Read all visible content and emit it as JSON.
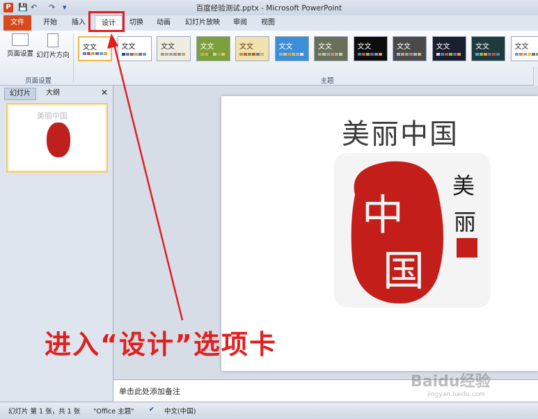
{
  "window": {
    "title": "百度经验测试.pptx - Microsoft PowerPoint",
    "app_icon": "P"
  },
  "qat": {
    "save": "💾",
    "undo": "↶",
    "redo": "↷",
    "more": "▾"
  },
  "ribbon_tabs": [
    "文件",
    "开始",
    "插入",
    "设计",
    "切换",
    "动画",
    "幻灯片放映",
    "审阅",
    "视图"
  ],
  "ribbon": {
    "page_setup_label": "页面设置",
    "orientation_label": "幻灯片方向",
    "group_page_setup": "页面设置",
    "group_themes": "主题",
    "theme_label": "文文"
  },
  "themes": [
    {
      "bg": "#ffffff",
      "fg": "#222222",
      "accents": [
        "#4f81bd",
        "#c0504d",
        "#9bbb59",
        "#8064a2",
        "#4bacc6",
        "#f79646"
      ]
    },
    {
      "bg": "#ffffff",
      "fg": "#222222",
      "accents": [
        "#1f497d",
        "#4f81bd",
        "#c0504d",
        "#9bbb59",
        "#8064a2",
        "#4bacc6"
      ]
    },
    {
      "bg": "#efece2",
      "fg": "#333333",
      "accents": [
        "#94a088",
        "#b5a48b",
        "#8aa6b4",
        "#a88f7c",
        "#7e9c82",
        "#c1a565"
      ]
    },
    {
      "bg": "#7ca03a",
      "fg": "#ffffff",
      "accents": [
        "#a5c249",
        "#e2a33a",
        "#6d8f3c",
        "#cfd98f",
        "#a4a35e",
        "#f0c25a"
      ]
    },
    {
      "bg": "#f1e2b2",
      "fg": "#5c3c10",
      "accents": [
        "#d08b2b",
        "#a86a2c",
        "#7d8f3b",
        "#c3502b",
        "#5a7f9b",
        "#d4b35c"
      ]
    },
    {
      "bg": "#3b8ed8",
      "fg": "#ffffff",
      "accents": [
        "#7fbde9",
        "#f2c94c",
        "#eb8d3b",
        "#a5d46a",
        "#c3a0e0",
        "#f0f0f0"
      ]
    },
    {
      "bg": "#68705a",
      "fg": "#ffffff",
      "accents": [
        "#a3b18a",
        "#d4c19c",
        "#8fa4b2",
        "#c98a73",
        "#9bb09f",
        "#e3d27d"
      ]
    },
    {
      "bg": "#0d0d0d",
      "fg": "#ffffff",
      "accents": [
        "#4f81bd",
        "#c0504d",
        "#9bbb59",
        "#8064a2",
        "#4bacc6",
        "#f79646"
      ]
    },
    {
      "bg": "#4a4a4a",
      "fg": "#ffffff",
      "accents": [
        "#9fb9d8",
        "#c5a36b",
        "#8fb08a",
        "#c07d7d",
        "#8ec5d0",
        "#dfb66b"
      ]
    },
    {
      "bg": "#1a1f2e",
      "fg": "#ffffff",
      "accents": [
        "#e0e0e0",
        "#4f81bd",
        "#c0504d",
        "#9bbb59",
        "#8064a2",
        "#f79646"
      ]
    },
    {
      "bg": "#1e3b3b",
      "fg": "#ffffff",
      "accents": [
        "#4bacc6",
        "#9bbb59",
        "#f79646",
        "#8064a2",
        "#c0504d",
        "#4f81bd"
      ]
    },
    {
      "bg": "#ffffff",
      "fg": "#333333",
      "accents": [
        "#5b9bd5",
        "#ed7d31",
        "#a5a5a5",
        "#ffc000",
        "#4472c4",
        "#70ad47"
      ]
    }
  ],
  "left_panel": {
    "tab_slides": "幻灯片",
    "tab_outline": "大纲",
    "close": "✕",
    "slide_number": "1"
  },
  "slide": {
    "title": "美丽中国",
    "seal_main": "中国",
    "seal_side": "美丽"
  },
  "notes_placeholder": "单击此处添加备注",
  "status": {
    "slide_info": "幻灯片 第 1 张，共 1 张",
    "theme": "\"Office 主题\"",
    "language": "中文(中国)"
  },
  "annotation": {
    "caption": "进入“设计”选项卡",
    "color": "#e01f1f"
  },
  "watermark": {
    "text": "Baidu经验",
    "sub": "jingyan.baidu.com"
  }
}
